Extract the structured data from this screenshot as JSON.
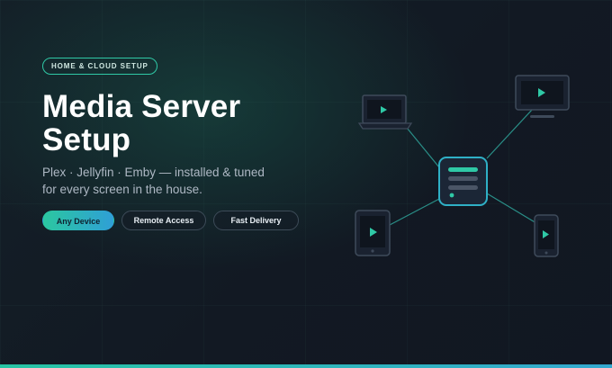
{
  "badge": "HOME & CLOUD SETUP",
  "title": "Media Server\nSetup",
  "subtitle": "Plex · Jellyfin · Emby — installed & tuned\nfor every screen in the house.",
  "pills": [
    {
      "label": "Any Device",
      "style": "primary"
    },
    {
      "label": "Remote Access",
      "style": "outline"
    },
    {
      "label": "Fast Delivery",
      "style": "outline"
    }
  ],
  "diagram": {
    "nodes": [
      "server-icon",
      "laptop-icon",
      "monitor-icon",
      "tablet-icon",
      "phone-icon"
    ]
  },
  "colors": {
    "accent": "#2fc9a6",
    "accent_blue": "#2f9fd6",
    "background": "#131a24",
    "device_stroke": "#3e4a5a"
  }
}
